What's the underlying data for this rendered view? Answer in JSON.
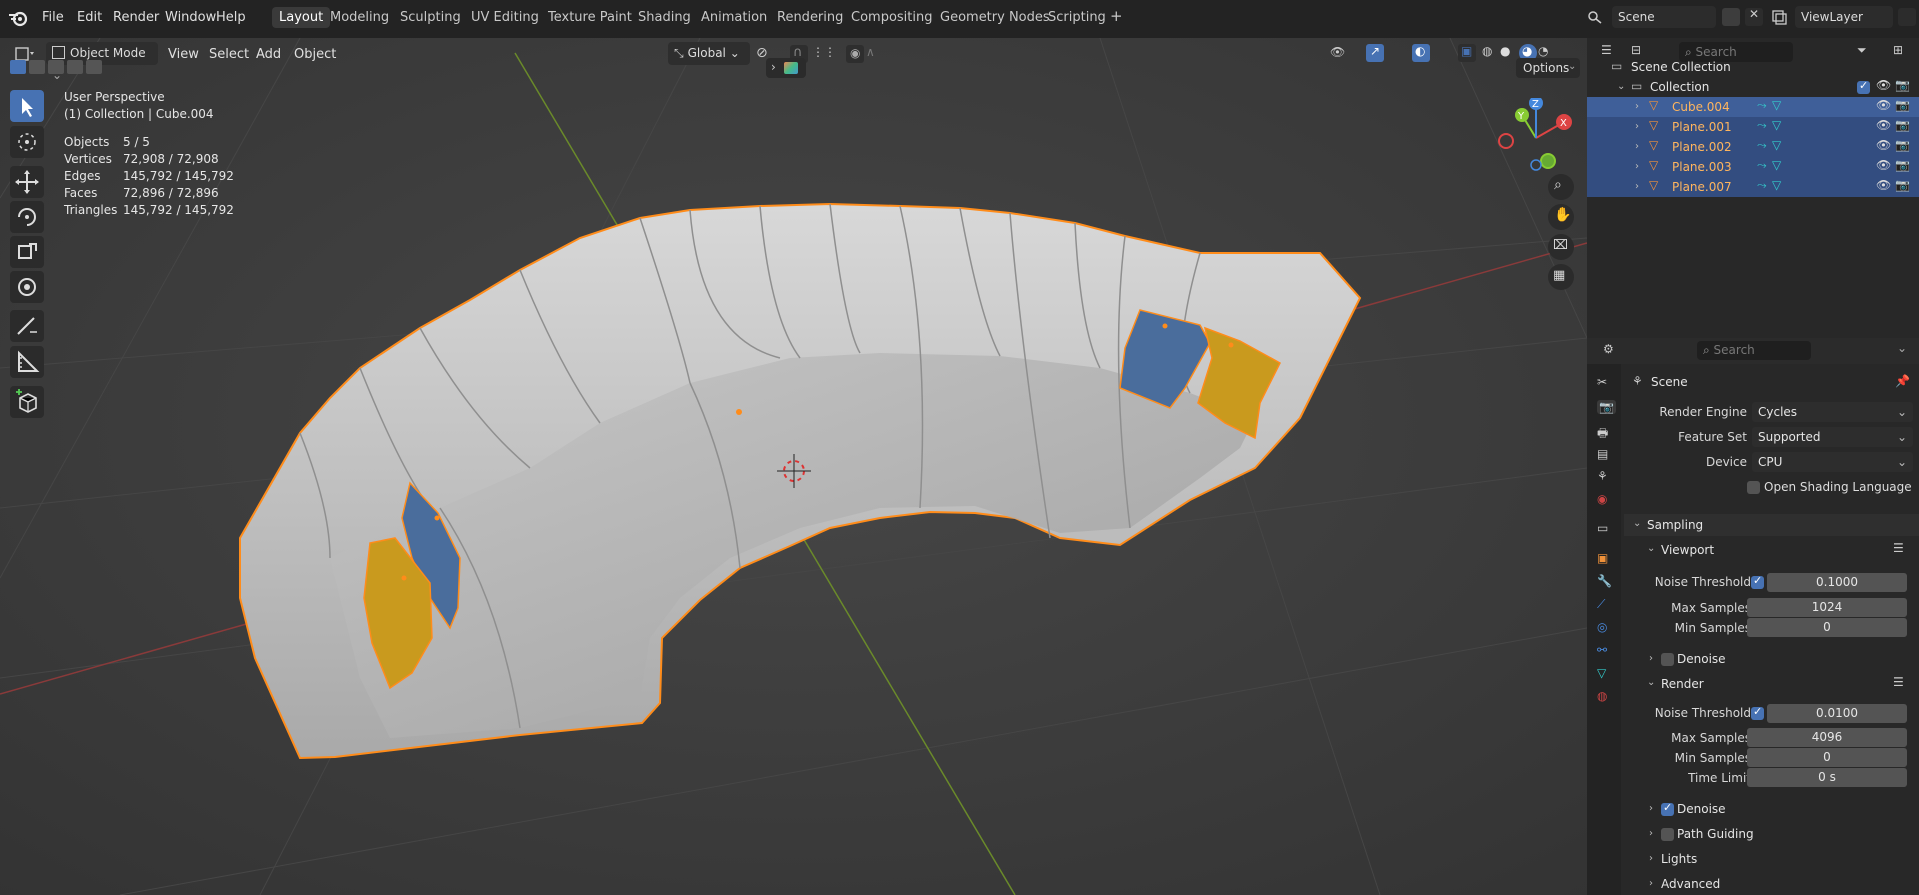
{
  "menu": [
    "File",
    "Edit",
    "Render",
    "Window",
    "Help"
  ],
  "workspaces": [
    "Layout",
    "Modeling",
    "Sculpting",
    "UV Editing",
    "Texture Paint",
    "Shading",
    "Animation",
    "Rendering",
    "Compositing",
    "Geometry Nodes",
    "Scripting"
  ],
  "active_workspace": "Layout",
  "scene_name": "Scene",
  "view_layer": "ViewLayer",
  "viewport_header": {
    "mode": "Object Mode",
    "view": "View",
    "select": "Select",
    "add": "Add",
    "object": "Object",
    "transform": "Global",
    "search_placeholder": "Search",
    "options": "Options"
  },
  "overlay_info": {
    "perspective": "User Perspective",
    "collection": "(1) Collection | Cube.004",
    "stats": [
      {
        "label": "Objects",
        "value": "5 / 5"
      },
      {
        "label": "Vertices",
        "value": "72,908 / 72,908"
      },
      {
        "label": "Edges",
        "value": "145,792 / 145,792"
      },
      {
        "label": "Faces",
        "value": "72,896 / 72,896"
      },
      {
        "label": "Triangles",
        "value": "145,792 / 145,792"
      }
    ]
  },
  "gizmo_axes": {
    "x": "X",
    "y": "Y",
    "z": "Z"
  },
  "outliner": {
    "root": "Scene Collection",
    "collection": "Collection",
    "objects": [
      "Cube.004",
      "Plane.001",
      "Plane.002",
      "Plane.003",
      "Plane.007"
    ],
    "search_placeholder": "Search"
  },
  "properties": {
    "search_placeholder": "Search",
    "context": "Scene",
    "render_engine_label": "Render Engine",
    "render_engine": "Cycles",
    "feature_set_label": "Feature Set",
    "feature_set": "Supported",
    "device_label": "Device",
    "device": "CPU",
    "osl_label": "Open Shading Language",
    "sampling": "Sampling",
    "viewport": {
      "title": "Viewport",
      "noise_threshold_label": "Noise Threshold",
      "noise_threshold": "0.1000",
      "max_samples_label": "Max Samples",
      "max_samples": "1024",
      "min_samples_label": "Min Samples",
      "min_samples": "0",
      "denoise": "Denoise"
    },
    "render": {
      "title": "Render",
      "noise_threshold_label": "Noise Threshold",
      "noise_threshold": "0.0100",
      "max_samples_label": "Max Samples",
      "max_samples": "4096",
      "min_samples_label": "Min Samples",
      "min_samples": "0",
      "time_limit_label": "Time Limit",
      "time_limit": "0 s",
      "denoise": "Denoise",
      "path_guiding": "Path Guiding"
    },
    "lights": "Lights",
    "advanced": "Advanced"
  },
  "colors": {
    "selection_outline": "#ff8c1a",
    "accent": "#4772b3",
    "pillow_blue": "#4a6d9c",
    "pillow_yellow": "#c99a1e"
  }
}
